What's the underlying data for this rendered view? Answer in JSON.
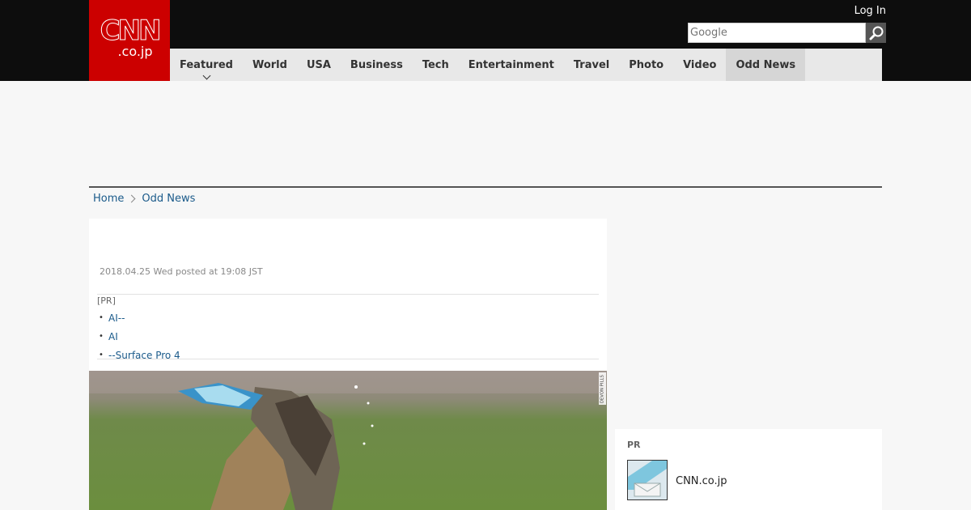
{
  "header": {
    "logo_main": "CNN",
    "logo_sub": ".co.jp",
    "login_label": "Log In",
    "search_placeholder": "Google"
  },
  "nav": {
    "items": [
      {
        "label": "Featured",
        "has_dropdown": true
      },
      {
        "label": "World"
      },
      {
        "label": "USA"
      },
      {
        "label": "Business"
      },
      {
        "label": "Tech"
      },
      {
        "label": "Entertainment"
      },
      {
        "label": "Travel"
      },
      {
        "label": "Photo"
      },
      {
        "label": "Video"
      },
      {
        "label": "Odd News",
        "active": true
      }
    ]
  },
  "breadcrumb": {
    "home": "Home",
    "current": "Odd News"
  },
  "article": {
    "dateline": "2018.04.25 Wed posted at 19:08 JST",
    "pr_label": "[PR]",
    "pr_links": [
      "AI--",
      "AI",
      "--Surface Pro 4"
    ],
    "photo_credit": "DEVON PILLS"
  },
  "sidebar_pr": {
    "label": "PR",
    "item_name": "CNN.co.jp"
  },
  "colors": {
    "brand_red": "#cc0000",
    "header_bg": "#0d0d0d",
    "link_blue": "#1a5a8a"
  }
}
